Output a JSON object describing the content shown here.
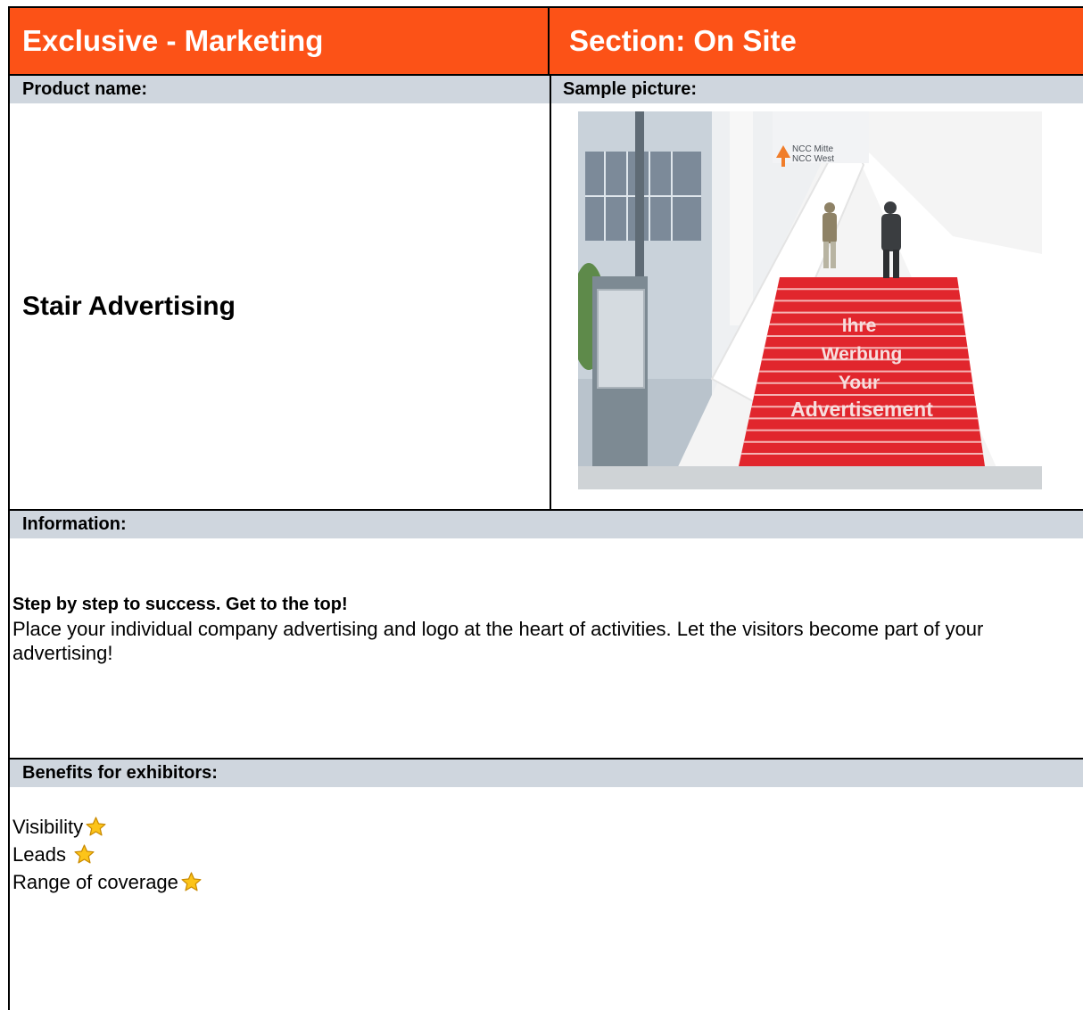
{
  "header": {
    "left_title": "Exclusive - Marketing",
    "right_title": "Section: On Site"
  },
  "product": {
    "label": "Product name:",
    "name": "Stair Advertising"
  },
  "sample": {
    "label": "Sample picture:",
    "sign_line1": "NCC Mitte",
    "sign_line2": "NCC West",
    "stair_text": [
      "Ihre",
      "Werbung",
      "Your",
      "Advertisement"
    ]
  },
  "information": {
    "label": "Information:",
    "headline": "Step by step to success. Get to the top!",
    "body": "Place your individual company advertising and logo at the heart of activities. Let the visitors become part of your advertising!"
  },
  "benefits": {
    "label": "Benefits for exhibitors:",
    "items": [
      "Visibility",
      "Leads ",
      "Range of coverage"
    ],
    "star_icon": "star-icon",
    "star_color": "#fcc419"
  },
  "colors": {
    "header_bg": "#fc5217",
    "band_bg": "#cfd6de",
    "stair_red": "#e1262d"
  }
}
